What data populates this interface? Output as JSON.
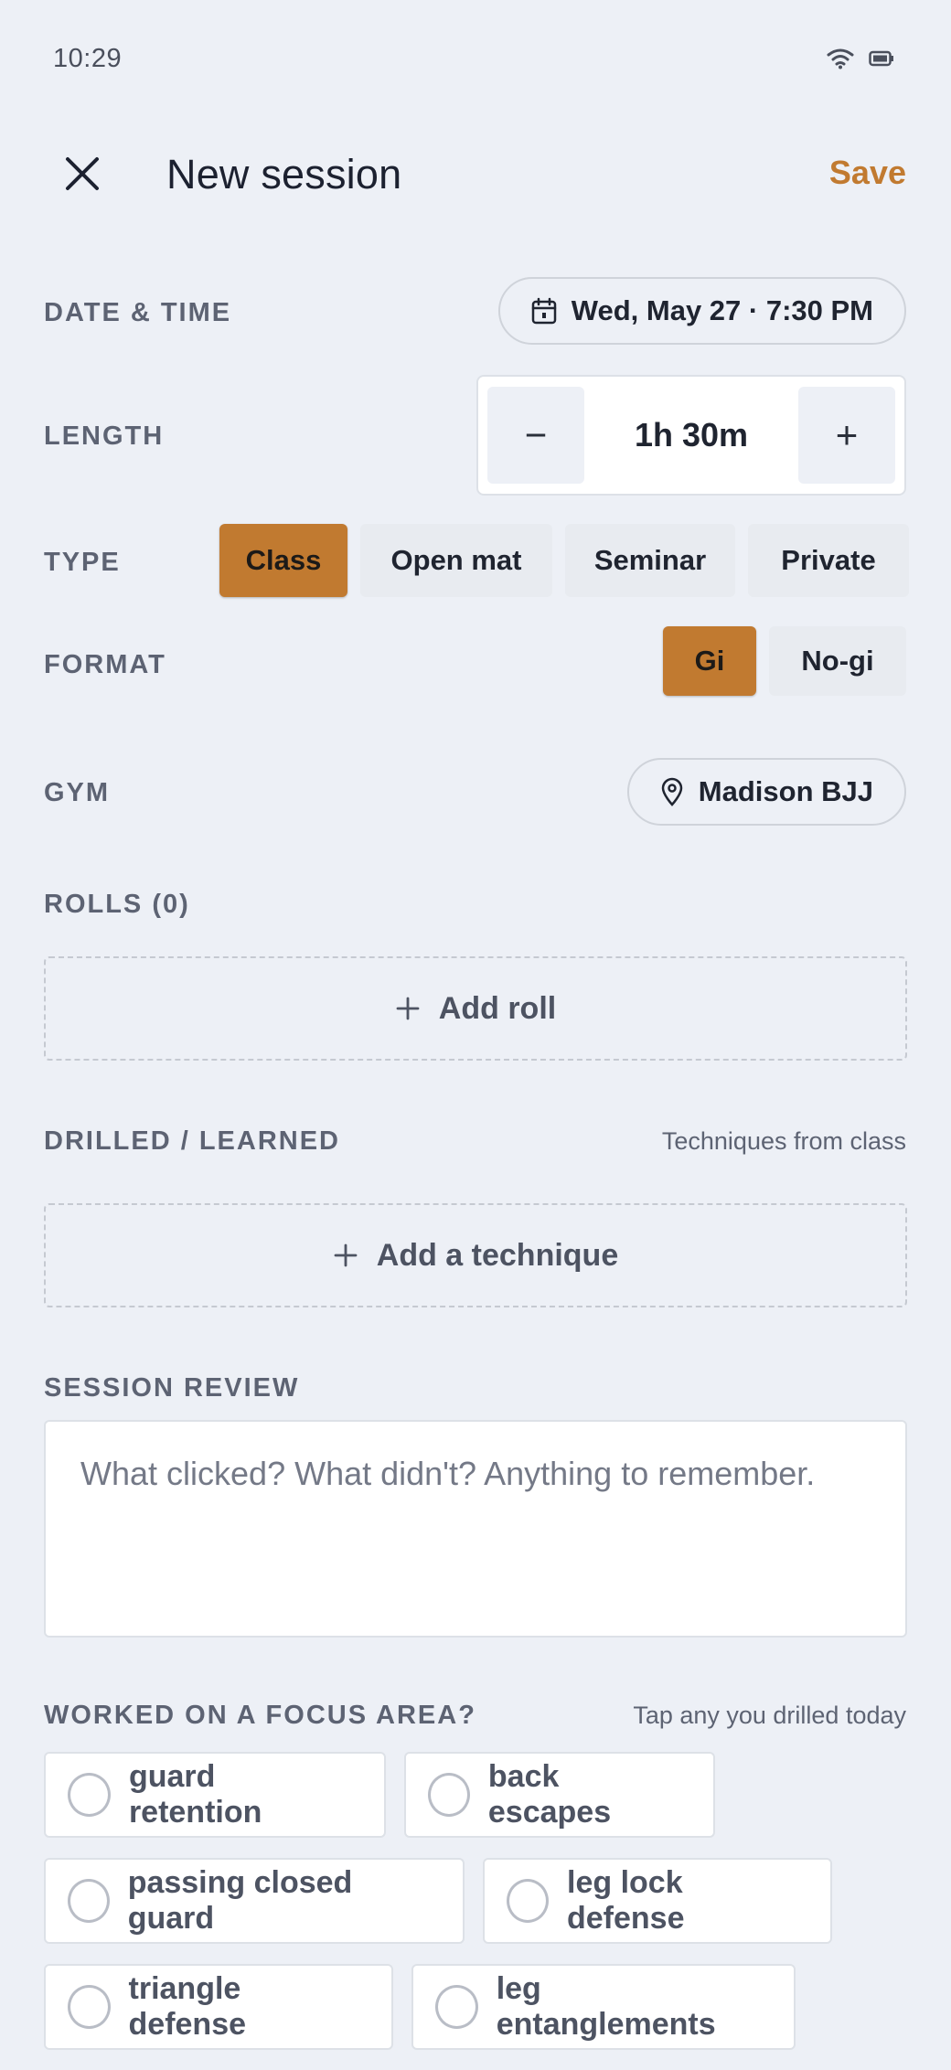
{
  "status": {
    "time": "10:29"
  },
  "header": {
    "title": "New session",
    "save_label": "Save",
    "close_icon": "close-icon"
  },
  "date_time": {
    "label": "DATE & TIME",
    "value": "Wed, May 27 · 7:30 PM"
  },
  "length": {
    "label": "LENGTH",
    "value": "1h 30m",
    "decrement": "−",
    "increment": "+"
  },
  "type": {
    "label": "TYPE",
    "options": [
      "Class",
      "Open mat",
      "Seminar",
      "Private"
    ],
    "selected": "Class"
  },
  "format": {
    "label": "FORMAT",
    "options": [
      "Gi",
      "No-gi"
    ],
    "selected": "Gi"
  },
  "gym": {
    "label": "GYM",
    "value": "Madison BJJ"
  },
  "rolls": {
    "label": "ROLLS (0)",
    "add_label": "Add roll"
  },
  "drilled": {
    "label": "DRILLED / LEARNED",
    "hint": "Techniques from class",
    "add_label": "Add a technique"
  },
  "review": {
    "label": "SESSION REVIEW",
    "placeholder": "What clicked? What didn't? Anything to remember."
  },
  "focus": {
    "label": "WORKED ON A FOCUS AREA?",
    "hint": "Tap any you drilled today",
    "areas": [
      "guard retention",
      "back escapes",
      "passing closed guard",
      "leg lock defense",
      "triangle defense",
      "leg entanglements"
    ]
  },
  "colors": {
    "accent": "#c17a30",
    "background": "#edf0f6"
  }
}
